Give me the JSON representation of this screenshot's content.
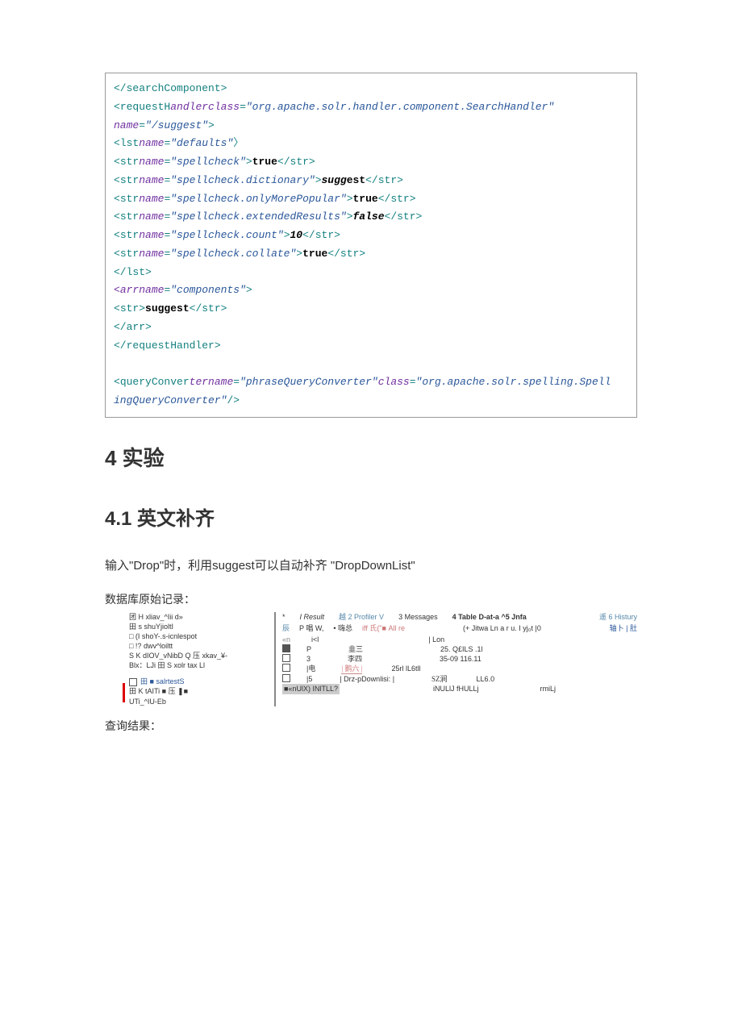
{
  "code": {
    "l1a": "</",
    "l1b": "searchComponent",
    "l1c": ">",
    "l2a": "<",
    "l2b": "requestH",
    "l2c": "andler",
    "l2d": "class",
    "l2e": "=",
    "l2f": "\"org.apache.solr.handler.component.SearchHandler\"",
    "l3a": "name",
    "l3b": "=",
    "l3c": "\"/suggest\"",
    "l3d": ">",
    "l4a": "<",
    "l4b": "lst",
    "l4c": "name",
    "l4d": "=",
    "l4e": "\"defaults\"",
    "l4f": "〉",
    "l5a": "<",
    "l5b": "str",
    "l5c": "name",
    "l5d": "=",
    "l5e": "\"spellcheck\"",
    "l5f": ">",
    "l5g": "true",
    "l5h": "</",
    "l5i": "str",
    "l5j": ">",
    "l6a": "<",
    "l6b": "str",
    "l6c": "name",
    "l6d": "=",
    "l6e": "\"spellcheck.dictionary\"",
    "l6f": ">",
    "l6g": "sugg",
    "l6h": "est",
    "l6i": "</",
    "l6j": "str",
    "l6k": ">",
    "l7a": "<",
    "l7b": "str",
    "l7c": "name",
    "l7d": "=",
    "l7e": "\"spellcheck.onlyMorePopular\"",
    "l7f": ">",
    "l7g": "true",
    "l7h": "</",
    "l7i": "str",
    "l7j": ">",
    "l8a": "<",
    "l8b": "str",
    "l8c": "name",
    "l8d": "=",
    "l8e": "\"spellcheck.extendedResults\"",
    "l8f": ">",
    "l8g": "false",
    "l8h": "</",
    "l8i": "str",
    "l8j": ">",
    "l9a": "<",
    "l9b": "str",
    "l9c": "name",
    "l9d": "=",
    "l9e": "\"spellcheck.count\"",
    "l9f": ">",
    "l9g": "10",
    "l9h": "</",
    "l9i": "str",
    "l9j": ">",
    "l10a": "<",
    "l10b": "str",
    "l10c": "name",
    "l10d": "=",
    "l10e": "\"spellcheck.collate\"",
    "l10f": ">",
    "l10g": "true",
    "l10h": "</",
    "l10i": "str",
    "l10j": ">",
    "l11a": "</",
    "l11b": "lst",
    "l11c": ">",
    "l12a": "<",
    "l12b": "arr",
    "l12c": "name",
    "l12d": "=",
    "l12e": "\"components\"",
    "l12f": ">",
    "l13a": "<",
    "l13b": "str",
    "l13c": ">",
    "l13d": "suggest",
    "l13e": "</",
    "l13f": "str",
    "l13g": ">",
    "l14a": "</",
    "l14b": "arr",
    "l14c": ">",
    "l15a": "</",
    "l15b": "requestHandler",
    "l15c": ">",
    "l16a": "<",
    "l16b": "queryConver",
    "l16c": "ter",
    "l16d": "name",
    "l16e": "=",
    "l16f": "\"phraseQueryConverter\"",
    "l16g": "class",
    "l16h": "=",
    "l16i": "\"org.apache.solr.spelling.Spell",
    "l17a": "ingQueryConverter\"",
    "l17b": "/>"
  },
  "headings": {
    "h4": "4 实验",
    "h41": "4.1 英文补齐"
  },
  "text": {
    "intro": "输入\"Drop\"时，利用suggest可以自动补齐 \"DropDownList\"",
    "dblabel": "数据库原始记录：",
    "reslabel": "查询结果："
  },
  "tree": {
    "r1": "团 H xliav_^Iii d»",
    "r2": "田 s shuYjioltI",
    "r3": "□ (I shoY-.s-icnlespot",
    "r4": "□ !? dwv^loiltt",
    "r5": "S K dIOV_vNibD Q 压 xkav_¥-",
    "r6": "Blx：LJi 田 S xolr tax Ll",
    "r7": "田 ■ salrtestS",
    "r8": "田 K tAITi ■ 压 ❚■",
    "r9": "UTi_^IU-Eb"
  },
  "grid": {
    "tabs": {
      "t0": "*",
      "t1": "I Result",
      "t2": "越 2 Profiler V",
      "t3": "3 Messages",
      "t4": "4 Table D-at-a ^5 Jnfa",
      "t6": "遥 6 Histury"
    },
    "head": {
      "h1": "辰",
      "h2": "P 唱 W,",
      "h3": "• 嗨总",
      "h4": "iff 氏(\"■ All re",
      "h5": "(+ Jitwa Ln a r u. I yj₀t |0",
      "h6": "轴卜 |  肚"
    },
    "rows": {
      "r0a": "«n",
      "r0b": "i<l",
      "r0c": "| Lon",
      "r1a": "P",
      "r1b": "韭三",
      "r1c": "25. Q£ILS .1l",
      "r2a": "3",
      "r2b": "李四",
      "r2c": "35-09 116.11",
      "r3a": "|电",
      "r3b": "|    鹅六            |",
      "r3c": "25rl lL6tll",
      "r4a": "|5",
      "r4b": "| Drz-pDownlisi: |",
      "r4c": "SZ涧",
      "r4d": "LL6.0",
      "r5a": "■«nUlX) INlTLL?",
      "r5b": "iNULlJ fHULLj",
      "r5c": "rmiLj"
    }
  }
}
